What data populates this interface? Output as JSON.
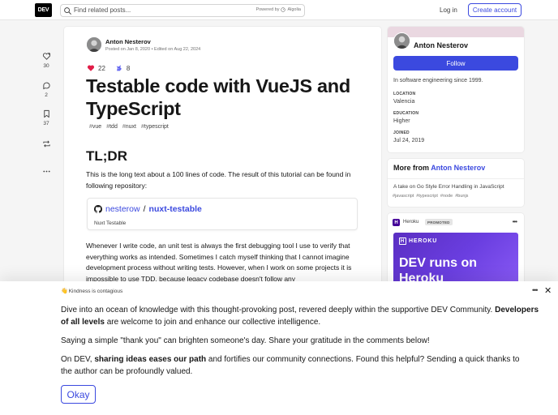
{
  "header": {
    "logo": "DEV",
    "search_placeholder": "Find related posts...",
    "powered_by": "Powered by",
    "algolia": "Algolia",
    "login": "Log in",
    "create_account": "Create account"
  },
  "reactions_sidebar": [
    {
      "icon": "heart-plus-icon",
      "count": "30"
    },
    {
      "icon": "comment-icon",
      "count": "2"
    },
    {
      "icon": "bookmark-icon",
      "count": "37"
    },
    {
      "icon": "share-icon",
      "count": ""
    },
    {
      "icon": "more-icon",
      "count": ""
    }
  ],
  "article": {
    "author": "Anton Nesterov",
    "posted": "Posted on Jan 8, 2020 • Edited on Aug 22, 2024",
    "reaction_hearts": "22",
    "reaction_unicorns": "8",
    "title": "Testable code with VueJS and TypeScript",
    "tags": [
      "vue",
      "tdd",
      "nuxt",
      "typescript"
    ],
    "heading": "TL;DR",
    "intro": "This is the long text about a 100 lines of code. The result of this tutorial can be found in following repository:",
    "repo": {
      "owner": "nesterow",
      "separator": "/",
      "name": "nuxt-testable",
      "description": "Nuxt Testable"
    },
    "body": "Whenever I write code, an unit test is always the first debugging tool I use to verify that everything works as intended. Sometimes I catch myself thinking that I cannot imagine development process without writing tests. However, when I work on some projects it is impossible to use TDD, because legacy codebase doesn't follow any"
  },
  "profile": {
    "name": "Anton Nesterov",
    "follow": "Follow",
    "bio": "In software engineering since 1999.",
    "fields": [
      {
        "label": "LOCATION",
        "value": "Valencia"
      },
      {
        "label": "EDUCATION",
        "value": "Higher"
      },
      {
        "label": "JOINED",
        "value": "Jul 24, 2019"
      }
    ]
  },
  "more_from": {
    "prefix": "More from",
    "author": "Anton Nesterov",
    "item_title": "A take on Go Style Error Handling in JavaScript",
    "item_tags": [
      "javascript",
      "typescript",
      "node",
      "bunjs"
    ]
  },
  "sponsor": {
    "logo_letter": "H",
    "name": "Heroku",
    "badge": "PROMOTED",
    "menu": "•••",
    "banner_logo": "HEROKU",
    "banner_text": "DEV runs on Heroku"
  },
  "overlay": {
    "tag": "Kindness is contagious",
    "menu": "•••",
    "close": "✕",
    "p1_a": "Dive into an ocean of knowledge with this thought-provoking post, revered deeply within the supportive DEV Community. ",
    "p1_b": "Developers of all levels",
    "p1_c": " are welcome to join and enhance our collective intelligence.",
    "p2": "Saying a simple \"thank you\" can brighten someone's day. Share your gratitude in the comments below!",
    "p3_a": "On DEV, ",
    "p3_b": "sharing ideas eases our path",
    "p3_c": " and fortifies our community connections. Found this helpful? Sending a quick thanks to the author can be profoundly valued.",
    "ok": "Okay"
  }
}
